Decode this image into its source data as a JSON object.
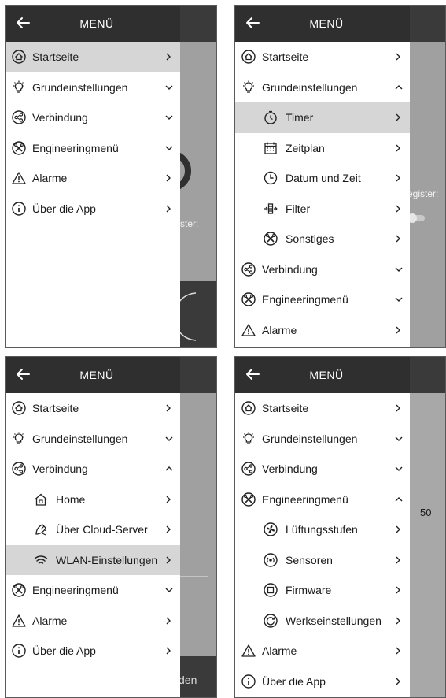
{
  "title": "MENÜ",
  "panels": [
    {
      "items": [
        {
          "label": "Startseite",
          "icon": "home-icon",
          "chevron": "right",
          "selected": true
        },
        {
          "label": "Grundeinstellungen",
          "icon": "bulb-icon",
          "chevron": "down"
        },
        {
          "label": "Verbindung",
          "icon": "share-icon",
          "chevron": "down"
        },
        {
          "label": "Engineeringmenü",
          "icon": "tools-icon",
          "chevron": "down"
        },
        {
          "label": "Alarme",
          "icon": "warning-icon",
          "chevron": "right"
        },
        {
          "label": "Über die App",
          "icon": "info-icon",
          "chevron": "right"
        }
      ],
      "background_text": "ster:"
    },
    {
      "items": [
        {
          "label": "Startseite",
          "icon": "home-icon",
          "chevron": "right"
        },
        {
          "label": "Grundeinstellungen",
          "icon": "bulb-icon",
          "chevron": "up"
        },
        {
          "label": "Timer",
          "icon": "timer-icon",
          "chevron": "right",
          "sub": true,
          "selected": true
        },
        {
          "label": "Zeitplan",
          "icon": "calendar-icon",
          "chevron": "right",
          "sub": true
        },
        {
          "label": "Datum und Zeit",
          "icon": "clock-icon",
          "chevron": "right",
          "sub": true
        },
        {
          "label": "Filter",
          "icon": "filter-icon",
          "chevron": "right",
          "sub": true
        },
        {
          "label": "Sonstiges",
          "icon": "tools-icon",
          "chevron": "right",
          "sub": true
        },
        {
          "label": "Verbindung",
          "icon": "share-icon",
          "chevron": "down"
        },
        {
          "label": "Engineeringmenü",
          "icon": "tools-icon",
          "chevron": "down"
        },
        {
          "label": "Alarme",
          "icon": "warning-icon",
          "chevron": "right"
        }
      ],
      "background_text": "register:"
    },
    {
      "items": [
        {
          "label": "Startseite",
          "icon": "home-icon",
          "chevron": "right"
        },
        {
          "label": "Grundeinstellungen",
          "icon": "bulb-icon",
          "chevron": "down"
        },
        {
          "label": "Verbindung",
          "icon": "share-icon",
          "chevron": "up"
        },
        {
          "label": "Home",
          "icon": "house-icon",
          "chevron": "right",
          "sub": true
        },
        {
          "label": "Über Cloud-Server",
          "icon": "satellite-icon",
          "chevron": "right",
          "sub": true
        },
        {
          "label": "WLAN-Einstellungen",
          "icon": "wifi-icon",
          "chevron": "right",
          "sub": true,
          "selected": true
        },
        {
          "label": "Engineeringmenü",
          "icon": "tools-icon",
          "chevron": "down"
        },
        {
          "label": "Alarme",
          "icon": "warning-icon",
          "chevron": "right"
        },
        {
          "label": "Über die App",
          "icon": "info-icon",
          "chevron": "right"
        }
      ],
      "background_text": "den"
    },
    {
      "items": [
        {
          "label": "Startseite",
          "icon": "home-icon",
          "chevron": "right"
        },
        {
          "label": "Grundeinstellungen",
          "icon": "bulb-icon",
          "chevron": "down"
        },
        {
          "label": "Verbindung",
          "icon": "share-icon",
          "chevron": "down"
        },
        {
          "label": "Engineeringmenü",
          "icon": "tools-icon",
          "chevron": "up"
        },
        {
          "label": "Lüftungsstufen",
          "icon": "fan-icon",
          "chevron": "right",
          "sub": true
        },
        {
          "label": "Sensoren",
          "icon": "sensor-icon",
          "chevron": "right",
          "sub": true
        },
        {
          "label": "Firmware",
          "icon": "chip-icon",
          "chevron": "right",
          "sub": true
        },
        {
          "label": "Werkseinstellungen",
          "icon": "reset-icon",
          "chevron": "right",
          "sub": true
        },
        {
          "label": "Alarme",
          "icon": "warning-icon",
          "chevron": "right"
        },
        {
          "label": "Über die App",
          "icon": "info-icon",
          "chevron": "right"
        }
      ],
      "background_text": "50"
    }
  ]
}
